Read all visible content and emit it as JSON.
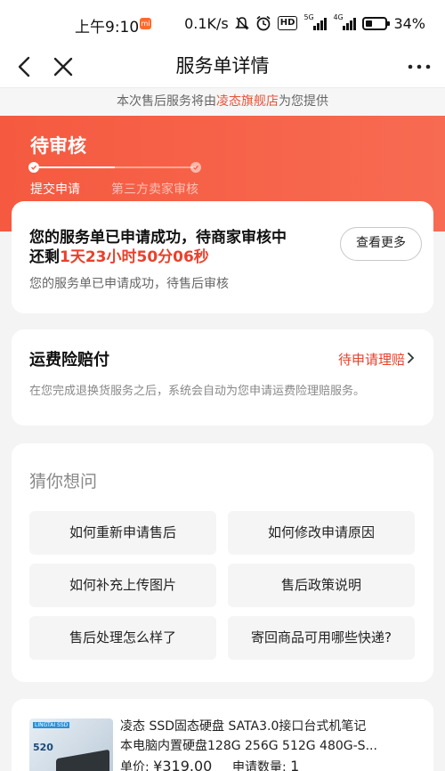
{
  "status_bar": {
    "time": "上午9:10",
    "network_speed": "0.1K/s",
    "battery": "34%",
    "hd_label": "HD",
    "net_a": "5G",
    "net_b": "4G"
  },
  "nav": {
    "title": "服务单详情"
  },
  "provider": {
    "prefix": "本次售后服务将由",
    "shop": "凌态旗舰店",
    "suffix": "为您提供"
  },
  "progress_header": {
    "title": "待审核",
    "steps": [
      "提交申请",
      "第三方卖家审核"
    ],
    "progress_fraction": 0.5
  },
  "status_card": {
    "main_text": "您的服务单已申请成功，待商家审核中",
    "remaining_prefix": "还剩",
    "remaining_time": "1天23小时50分06秒",
    "more_button": "查看更多",
    "sub_text": "您的服务单已申请成功，待售后审核"
  },
  "insurance_card": {
    "title": "运费险赔付",
    "status": "待申请理赔",
    "description": "在您完成退换货服务之后，系统会自动为您申请运费险理赔服务。"
  },
  "faq": {
    "title": "猜你想问",
    "questions": [
      "如何重新申请售后",
      "如何修改申请原因",
      "如何补充上传图片",
      "售后政策说明",
      "售后处理怎么样了",
      "寄回商品可用哪些快递?"
    ]
  },
  "product": {
    "title_line1": "凌态  SSD固态硬盘 SATA3.0接口台式机笔记",
    "title_line2": "本电脑内置硬盘128G 256G 512G 480G-S...",
    "price_label": "单价:",
    "price_value": "¥319.00",
    "qty_label": "申请数量:",
    "qty_value": "1",
    "image_brand": "LINGTAI SSD",
    "image_capacity": "520"
  },
  "colors": {
    "accent": "#e8412b",
    "header_bg": "#f55a40"
  }
}
